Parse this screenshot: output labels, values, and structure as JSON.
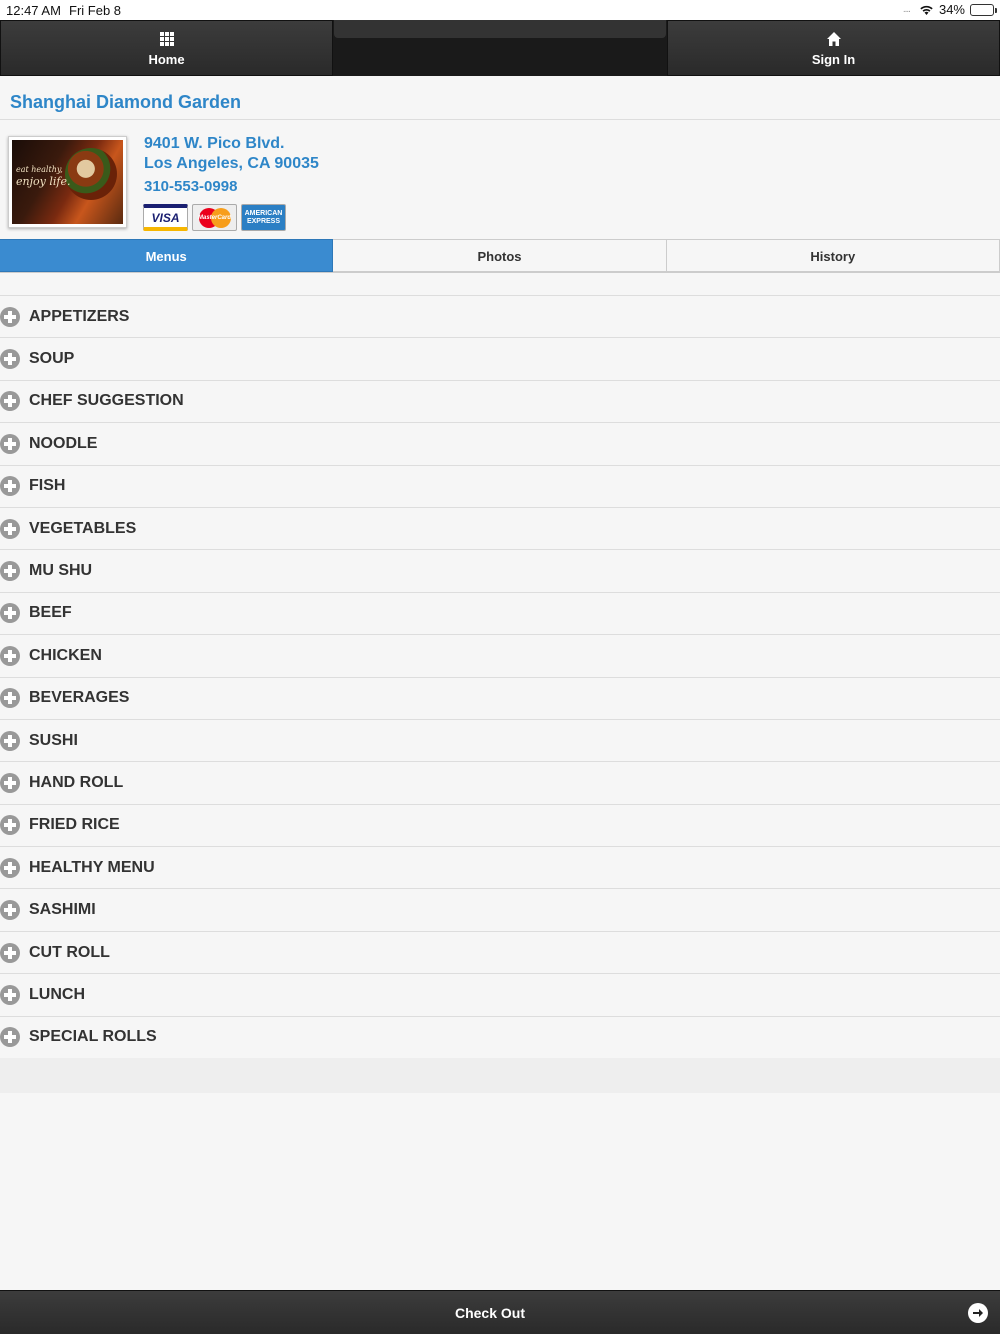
{
  "status_bar": {
    "time": "12:47 AM",
    "date": "Fri Feb 8",
    "signal": "....",
    "battery": "34%"
  },
  "nav": {
    "home_label": "Home",
    "signin_label": "Sign In"
  },
  "restaurant": {
    "name": "Shanghai Diamond Garden",
    "address_line1": "9401 W. Pico Blvd.",
    "address_line2": "Los Angeles, CA 90035",
    "phone": "310-553-0998",
    "image_tagline_1": "eat healthy,",
    "image_tagline_2": "enjoy life.",
    "cards": {
      "visa": "VISA",
      "mastercard": "MasterCard",
      "amex_1": "AMERICAN",
      "amex_2": "EXPRESS"
    }
  },
  "tabs": [
    {
      "label": "Menus",
      "active": true
    },
    {
      "label": "Photos",
      "active": false
    },
    {
      "label": "History",
      "active": false
    }
  ],
  "menu_categories": [
    "APPETIZERS",
    "SOUP",
    "CHEF SUGGESTION",
    "NOODLE",
    "FISH",
    "VEGETABLES",
    "MU SHU",
    "BEEF",
    "CHICKEN",
    "BEVERAGES",
    "SUSHI",
    "HAND ROLL",
    "FRIED RICE",
    "HEALTHY MENU",
    "SASHIMI",
    "CUT ROLL",
    "LUNCH",
    "SPECIAL ROLLS"
  ],
  "checkout": {
    "label": "Check Out"
  },
  "colors": {
    "accent": "#2e86c8",
    "active_tab": "#3a8bd0",
    "bar": "#2a2a2a"
  },
  "icons": {
    "home": "grid-icon",
    "signin": "house-icon",
    "category": "plus-circle-icon",
    "checkout": "arrow-right-icon"
  }
}
